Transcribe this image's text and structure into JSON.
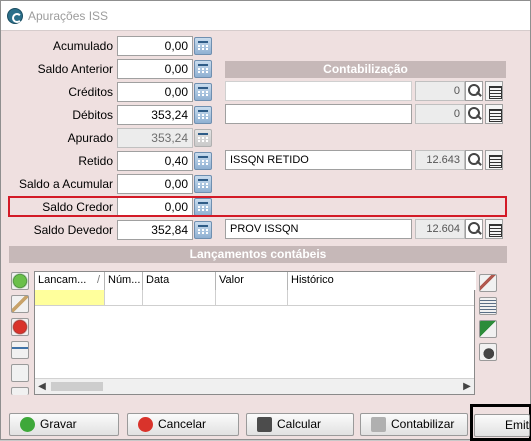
{
  "window": {
    "title": "Apurações ISS"
  },
  "fields": {
    "acumulado": {
      "label": "Acumulado",
      "value": "0,00"
    },
    "saldo_anterior": {
      "label": "Saldo Anterior",
      "value": "0,00"
    },
    "creditos": {
      "label": "Créditos",
      "value": "0,00"
    },
    "debitos": {
      "label": "Débitos",
      "value": "353,24"
    },
    "apurado": {
      "label": "Apurado",
      "value": "353,24"
    },
    "retido": {
      "label": "Retido",
      "value": "0,40"
    },
    "saldo_a_acumular": {
      "label": "Saldo a Acumular",
      "value": "0,00"
    },
    "saldo_credor": {
      "label": "Saldo Credor",
      "value": "0,00"
    },
    "saldo_devedor": {
      "label": "Saldo Devedor",
      "value": "352,84"
    }
  },
  "contabilizacao": {
    "header": "Contabilização",
    "creditos": {
      "description": "",
      "code": "0"
    },
    "debitos": {
      "description": "",
      "code": "0"
    },
    "retido": {
      "description": "ISSQN RETIDO",
      "code": "12.643"
    },
    "saldo_devedor": {
      "description": "PROV ISSQN",
      "code": "12.604"
    }
  },
  "lancamentos": {
    "header": "Lançamentos contábeis",
    "columns": [
      "Lancam...",
      "Núm...",
      "Data",
      "Valor",
      "Histórico"
    ],
    "sort_indicator": "/"
  },
  "buttons": {
    "gravar": "Gravar",
    "cancelar": "Cancelar",
    "calcular": "Calcular",
    "contabilizar": "Contabilizar",
    "emitir": "Emiti"
  },
  "colors": {
    "highlight": "#d31a27",
    "window_bg": "#efe0e0",
    "section_header": "#c6b8b8",
    "active_cell": "#ffff9c"
  }
}
